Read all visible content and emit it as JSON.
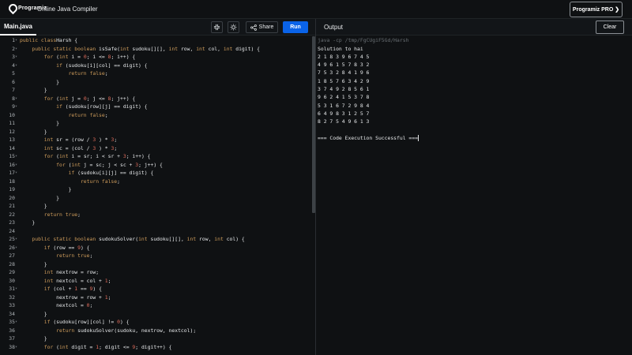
{
  "header": {
    "logo_text": "Programiz",
    "app_title": "Online Java Compiler",
    "pro_button": "Programiz PRO ❯"
  },
  "toolbar": {
    "tab_label": "Main.java",
    "share_label": "Share",
    "run_label": "Run",
    "output_label": "Output",
    "clear_label": "Clear"
  },
  "editor": {
    "lines": [
      {
        "n": "1",
        "fold": true,
        "tokens": [
          [
            "kw",
            "public class"
          ],
          [
            "",
            "Harsh {"
          ]
        ]
      },
      {
        "n": "2",
        "fold": true,
        "tokens": [
          [
            "",
            "    "
          ],
          [
            "kw",
            "public static boolean"
          ],
          [
            "",
            " isSafe("
          ],
          [
            "kw",
            "int"
          ],
          [
            "",
            " sudoku[][], "
          ],
          [
            "kw",
            "int"
          ],
          [
            "",
            " row, "
          ],
          [
            "kw",
            "int"
          ],
          [
            "",
            " col, "
          ],
          [
            "kw",
            "int"
          ],
          [
            "",
            " digit) {"
          ]
        ]
      },
      {
        "n": "3",
        "fold": true,
        "tokens": [
          [
            "",
            "        "
          ],
          [
            "kw",
            "for"
          ],
          [
            "",
            " ("
          ],
          [
            "kw",
            "int"
          ],
          [
            "",
            " i = "
          ],
          [
            "num",
            "0"
          ],
          [
            "",
            "; i <= "
          ],
          [
            "num",
            "8"
          ],
          [
            "",
            "; i++) {"
          ]
        ]
      },
      {
        "n": "4",
        "fold": true,
        "tokens": [
          [
            "",
            "            "
          ],
          [
            "kw",
            "if"
          ],
          [
            "",
            " (sudoku[i][col] == digit) {"
          ]
        ]
      },
      {
        "n": "5",
        "fold": false,
        "tokens": [
          [
            "",
            "                "
          ],
          [
            "kw",
            "return false"
          ],
          [
            "",
            ";"
          ]
        ]
      },
      {
        "n": "6",
        "fold": false,
        "tokens": [
          [
            "",
            "            }"
          ]
        ]
      },
      {
        "n": "7",
        "fold": false,
        "tokens": [
          [
            "",
            "        }"
          ]
        ]
      },
      {
        "n": "8",
        "fold": true,
        "tokens": [
          [
            "",
            "        "
          ],
          [
            "kw",
            "for"
          ],
          [
            "",
            " ("
          ],
          [
            "kw",
            "int"
          ],
          [
            "",
            " j = "
          ],
          [
            "num",
            "0"
          ],
          [
            "",
            "; j <= "
          ],
          [
            "num",
            "8"
          ],
          [
            "",
            "; j++) {"
          ]
        ]
      },
      {
        "n": "9",
        "fold": true,
        "tokens": [
          [
            "",
            "            "
          ],
          [
            "kw",
            "if"
          ],
          [
            "",
            " (sudoku[row][j] == digit) {"
          ]
        ]
      },
      {
        "n": "10",
        "fold": false,
        "tokens": [
          [
            "",
            "                "
          ],
          [
            "kw",
            "return false"
          ],
          [
            "",
            ";"
          ]
        ]
      },
      {
        "n": "11",
        "fold": false,
        "tokens": [
          [
            "",
            "            }"
          ]
        ]
      },
      {
        "n": "12",
        "fold": false,
        "tokens": [
          [
            "",
            "        }"
          ]
        ]
      },
      {
        "n": "13",
        "fold": false,
        "tokens": [
          [
            "",
            "        "
          ],
          [
            "kw",
            "int"
          ],
          [
            "",
            " sr = (row / "
          ],
          [
            "num",
            "3"
          ],
          [
            "",
            " ) * "
          ],
          [
            "num",
            "3"
          ],
          [
            "",
            ";"
          ]
        ]
      },
      {
        "n": "14",
        "fold": false,
        "tokens": [
          [
            "",
            "        "
          ],
          [
            "kw",
            "int"
          ],
          [
            "",
            " sc = (col / "
          ],
          [
            "num",
            "3"
          ],
          [
            "",
            " ) * "
          ],
          [
            "num",
            "3"
          ],
          [
            "",
            ";"
          ]
        ]
      },
      {
        "n": "15",
        "fold": true,
        "tokens": [
          [
            "",
            "        "
          ],
          [
            "kw",
            "for"
          ],
          [
            "",
            " ("
          ],
          [
            "kw",
            "int"
          ],
          [
            "",
            " i = sr; i < sr + "
          ],
          [
            "num",
            "3"
          ],
          [
            "",
            "; i++) {"
          ]
        ]
      },
      {
        "n": "16",
        "fold": true,
        "tokens": [
          [
            "",
            "            "
          ],
          [
            "kw",
            "for"
          ],
          [
            "",
            " ("
          ],
          [
            "kw",
            "int"
          ],
          [
            "",
            " j = sc; j < sc + "
          ],
          [
            "num",
            "3"
          ],
          [
            "",
            "; j++) {"
          ]
        ]
      },
      {
        "n": "17",
        "fold": true,
        "tokens": [
          [
            "",
            "                "
          ],
          [
            "kw",
            "if"
          ],
          [
            "",
            " (sudoku[i][j] == digit) {"
          ]
        ]
      },
      {
        "n": "18",
        "fold": false,
        "tokens": [
          [
            "",
            "                    "
          ],
          [
            "kw",
            "return false"
          ],
          [
            "",
            ";"
          ]
        ]
      },
      {
        "n": "19",
        "fold": false,
        "tokens": [
          [
            "",
            "                }"
          ]
        ]
      },
      {
        "n": "20",
        "fold": false,
        "tokens": [
          [
            "",
            "            }"
          ]
        ]
      },
      {
        "n": "21",
        "fold": false,
        "tokens": [
          [
            "",
            "        }"
          ]
        ]
      },
      {
        "n": "22",
        "fold": false,
        "tokens": [
          [
            "",
            "        "
          ],
          [
            "kw",
            "return true"
          ],
          [
            "",
            ";"
          ]
        ]
      },
      {
        "n": "23",
        "fold": false,
        "tokens": [
          [
            "",
            "    }"
          ]
        ]
      },
      {
        "n": "24",
        "fold": false,
        "tokens": [
          [
            "",
            ""
          ]
        ]
      },
      {
        "n": "25",
        "fold": true,
        "tokens": [
          [
            "",
            "    "
          ],
          [
            "kw",
            "public static boolean"
          ],
          [
            "",
            " sudokuSolver("
          ],
          [
            "kw",
            "int"
          ],
          [
            "",
            " sudoku[][], "
          ],
          [
            "kw",
            "int"
          ],
          [
            "",
            " row, "
          ],
          [
            "kw",
            "int"
          ],
          [
            "",
            " col) {"
          ]
        ]
      },
      {
        "n": "26",
        "fold": true,
        "tokens": [
          [
            "",
            "        "
          ],
          [
            "kw",
            "if"
          ],
          [
            "",
            " (row == "
          ],
          [
            "num",
            "9"
          ],
          [
            "",
            ") {"
          ]
        ]
      },
      {
        "n": "27",
        "fold": false,
        "tokens": [
          [
            "",
            "            "
          ],
          [
            "kw",
            "return true"
          ],
          [
            "",
            ";"
          ]
        ]
      },
      {
        "n": "28",
        "fold": false,
        "tokens": [
          [
            "",
            "        }"
          ]
        ]
      },
      {
        "n": "29",
        "fold": false,
        "tokens": [
          [
            "",
            "        "
          ],
          [
            "kw",
            "int"
          ],
          [
            "",
            " nextrow = row;"
          ]
        ]
      },
      {
        "n": "30",
        "fold": false,
        "tokens": [
          [
            "",
            "        "
          ],
          [
            "kw",
            "int"
          ],
          [
            "",
            " nextcol = col + "
          ],
          [
            "num",
            "1"
          ],
          [
            "",
            ";"
          ]
        ]
      },
      {
        "n": "31",
        "fold": true,
        "tokens": [
          [
            "",
            "        "
          ],
          [
            "kw",
            "if"
          ],
          [
            "",
            " (col + "
          ],
          [
            "num",
            "1"
          ],
          [
            "",
            " == "
          ],
          [
            "num",
            "9"
          ],
          [
            "",
            ") {"
          ]
        ]
      },
      {
        "n": "32",
        "fold": false,
        "tokens": [
          [
            "",
            "            nextrow = row + "
          ],
          [
            "num",
            "1"
          ],
          [
            "",
            ";"
          ]
        ]
      },
      {
        "n": "33",
        "fold": false,
        "tokens": [
          [
            "",
            "            nextcol = "
          ],
          [
            "num",
            "0"
          ],
          [
            "",
            ";"
          ]
        ]
      },
      {
        "n": "34",
        "fold": false,
        "tokens": [
          [
            "",
            "        }"
          ]
        ]
      },
      {
        "n": "35",
        "fold": true,
        "tokens": [
          [
            "",
            "        "
          ],
          [
            "kw",
            "if"
          ],
          [
            "",
            " (sudoku[row][col] != "
          ],
          [
            "num",
            "0"
          ],
          [
            "",
            ") {"
          ]
        ]
      },
      {
        "n": "36",
        "fold": false,
        "tokens": [
          [
            "",
            "            "
          ],
          [
            "kw",
            "return"
          ],
          [
            "",
            " sudokuSolver(sudoku, nextrow, nextcol);"
          ]
        ]
      },
      {
        "n": "37",
        "fold": false,
        "tokens": [
          [
            "",
            "        }"
          ]
        ]
      },
      {
        "n": "38",
        "fold": true,
        "tokens": [
          [
            "",
            "        "
          ],
          [
            "kw",
            "for"
          ],
          [
            "",
            " ("
          ],
          [
            "kw",
            "int"
          ],
          [
            "",
            " digit = "
          ],
          [
            "num",
            "1"
          ],
          [
            "",
            "; digit <= "
          ],
          [
            "num",
            "9"
          ],
          [
            "",
            "; digit++) {"
          ]
        ]
      }
    ]
  },
  "output": {
    "command": "java -cp /tmp/FgCUgiF5Gd/Harsh",
    "lines": [
      "Solution to hai",
      "2 1 8 3 9 6 7 4 5",
      "4 9 6 1 5 7 8 3 2",
      "7 5 3 2 8 4 1 9 6",
      "1 8 5 7 6 3 4 2 9",
      "3 7 4 9 2 8 5 6 1",
      "9 6 2 4 1 5 3 7 8",
      "5 3 1 6 7 2 9 8 4",
      "6 4 9 8 3 1 2 5 7",
      "8 2 7 5 4 9 6 1 3",
      "",
      "=== Code Execution Successful ==="
    ]
  }
}
